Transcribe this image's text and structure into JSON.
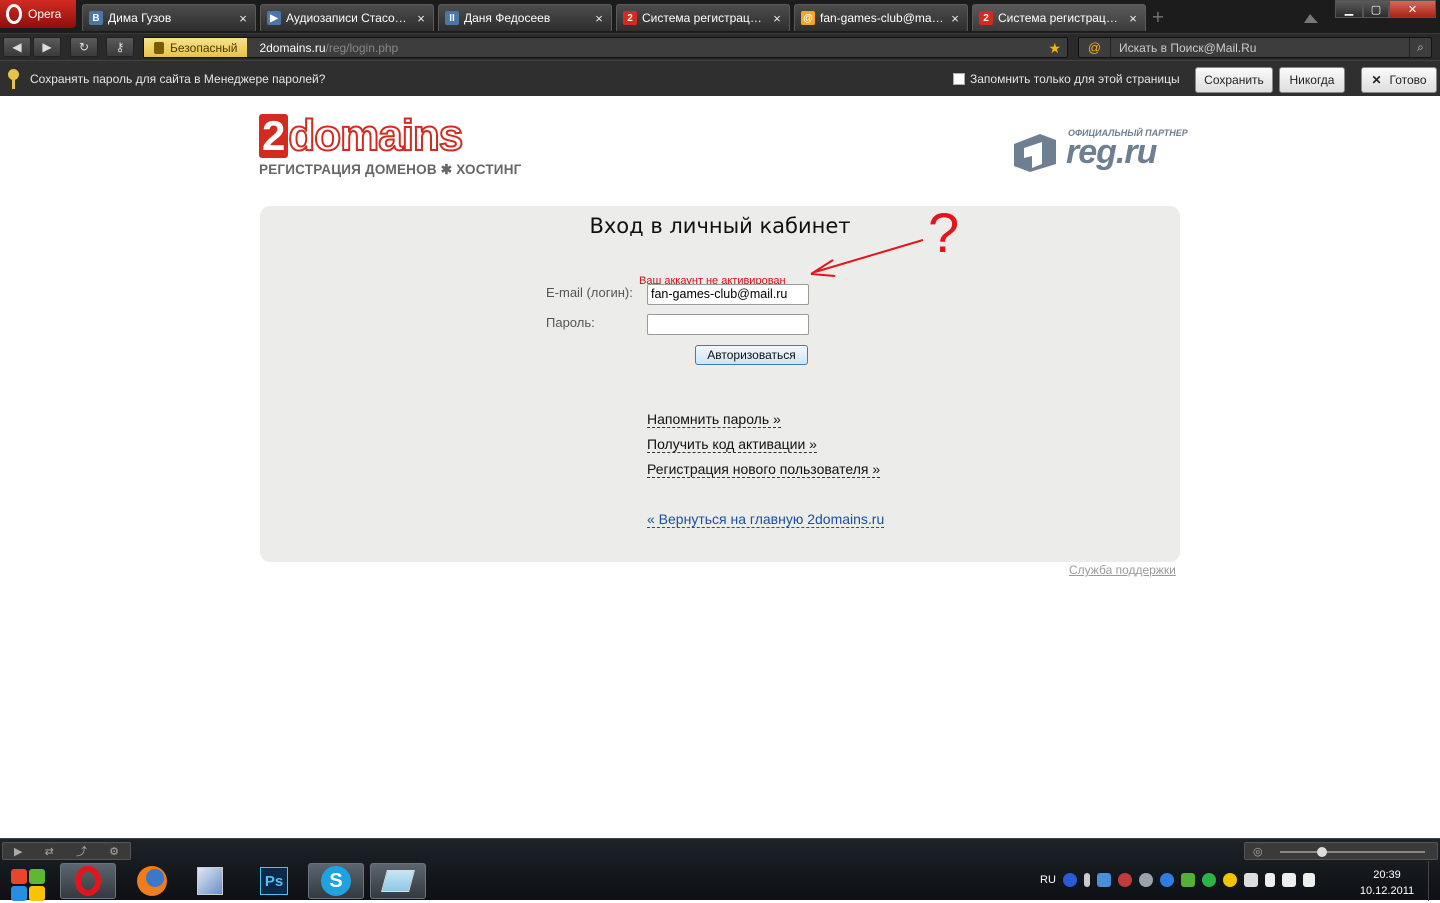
{
  "browser": {
    "menu_label": "Opera",
    "tabs": [
      {
        "title": "Дима Гузов",
        "favicon_text": "B",
        "favicon_color": "#4a76a8"
      },
      {
        "title": "Аудиозаписи Стасон...",
        "favicon_text": "▶",
        "favicon_color": "#4a76a8"
      },
      {
        "title": "Даня Федосеев",
        "favicon_text": "II",
        "favicon_color": "#4a76a8"
      },
      {
        "title": "Система регистраци...",
        "favicon_text": "2",
        "favicon_color": "#d32b1f"
      },
      {
        "title": "fan-games-club@mai...",
        "favicon_text": "@",
        "favicon_color": "#f5a623"
      },
      {
        "title": "Система регистраци...",
        "favicon_text": "2",
        "favicon_color": "#d32b1f"
      }
    ],
    "close_glyph": "×",
    "address": {
      "security_label": "Безопасный",
      "domain": "2domains.ru",
      "path": "/reg/login.php"
    },
    "search": {
      "placeholder": "Искать в Поиск@Mail.Ru"
    },
    "password_bar": {
      "message": "Сохранять пароль для сайта в Менеджере паролей?",
      "checkbox_label": "Запомнить только для этой страницы",
      "save": "Сохранить",
      "never": "Никогда",
      "done": "Готово"
    }
  },
  "page": {
    "logo_left": {
      "digit": "2",
      "word": "domains",
      "subtitle": "РЕГИСТРАЦИЯ ДОМЕНОВ ✱ ХОСТИНГ"
    },
    "logo_right": {
      "partner": "ОФИЦИАЛЬНЫЙ ПАРТНЕР",
      "brand": "reg.ru"
    },
    "login": {
      "title": "Вход в личный кабинет",
      "error": "Ваш аккаунт не активирован",
      "question_mark": "?",
      "email_label": "E-mail (логин):",
      "email_value": "fan-games-club@mail.ru",
      "password_label": "Пароль:",
      "password_value": "",
      "submit": "Авторизоваться",
      "links": {
        "remind": "Напомнить пароль »",
        "activation": "Получить код активации »",
        "register": "Регистрация нового пользователя »",
        "back": "« Вернуться на главную 2domains.ru"
      }
    },
    "support": "Служба поддержки"
  },
  "taskbar": {
    "language": "RU",
    "time": "20:39",
    "date": "10.12.2011",
    "apps": [
      "opera-icon",
      "firefox-icon",
      "paint-icon",
      "photoshop-icon",
      "skype-icon",
      "notepad-icon"
    ],
    "photoshop_label": "Ps"
  },
  "colors": {
    "brand_red": "#d32b1f",
    "error_red": "#d40f1c",
    "link_blue": "#1a4fa0",
    "box_gray": "#ececea"
  }
}
